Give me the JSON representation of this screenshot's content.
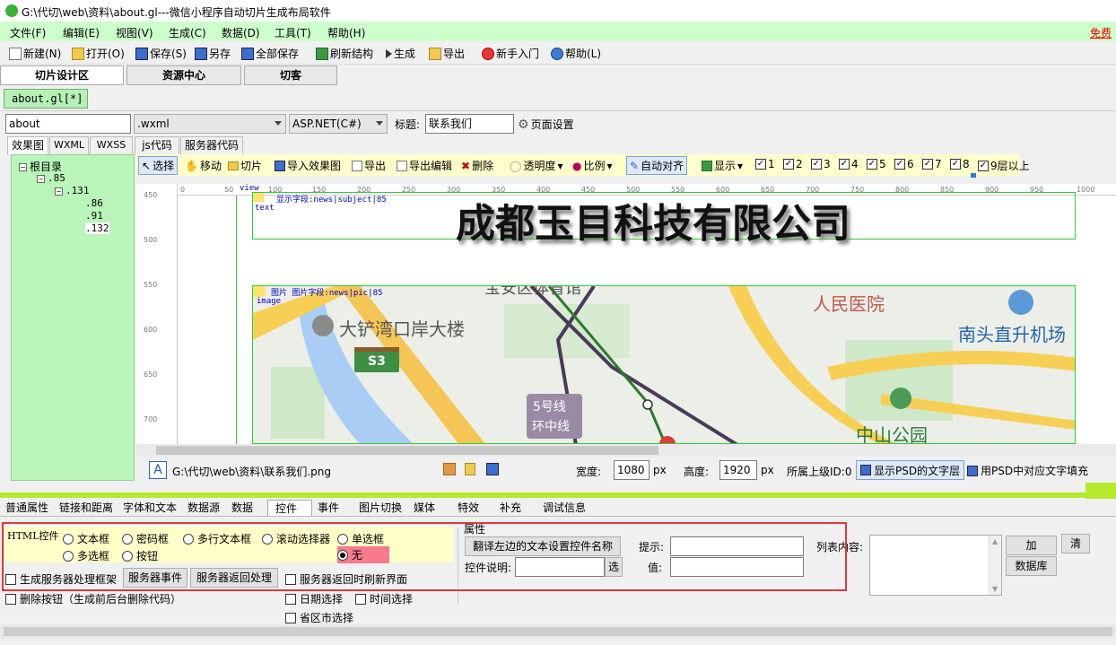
{
  "window": {
    "title": "G:\\代切\\web\\资料\\about.gl---微信小程序自动切片生成布局软件"
  },
  "menu": {
    "items": [
      "文件(F)",
      "编辑(E)",
      "视图(V)",
      "生成(C)",
      "数据(D)",
      "工具(T)",
      "帮助(H)"
    ],
    "right_link": "免费"
  },
  "toolbar": {
    "new": "新建(N)",
    "open": "打开(O)",
    "save": "保存(S)",
    "save_as": "另存",
    "save_all": "全部保存",
    "refresh": "刷新结构",
    "generate": "生成",
    "export": "导出",
    "tutorial": "新手入门",
    "help": "帮助(L)"
  },
  "main_tabs": [
    "切片设计区",
    "资源中心",
    "切客"
  ],
  "file_tab": "about.gl[*]",
  "inputs": {
    "name_value": "about",
    "ext_select": ".wxml",
    "lang_select": "ASP.NET(C#)",
    "title_label": "标题:",
    "title_value": "联系我们",
    "page_settings": "页面设置"
  },
  "sub_tabs": [
    "效果图",
    "WXML",
    "WXSS",
    "js代码",
    "服务器代码"
  ],
  "tree": {
    "root": "根目录",
    "n1": ".85",
    "n2": ".131",
    "leaves": [
      ".86",
      ".91",
      ".132"
    ]
  },
  "design_toolbar": {
    "select": "选择",
    "move": "移动",
    "slice": "切片",
    "import": "导入效果图",
    "export": "导出",
    "export_edit": "导出编辑",
    "delete": "删除",
    "opacity": "透明度",
    "ratio": "比例",
    "auto_align": "自动对齐",
    "display": "显示",
    "layers": [
      "1",
      "2",
      "3",
      "4",
      "5",
      "6",
      "7",
      "8",
      "9层以上"
    ]
  },
  "ruler": {
    "h": [
      "0",
      "50",
      "100",
      "150",
      "200",
      "250",
      "300",
      "350",
      "400",
      "450",
      "500",
      "550",
      "600",
      "650",
      "700",
      "750",
      "800",
      "850",
      "900",
      "950",
      "1000"
    ],
    "v": [
      "450",
      "500",
      "550",
      "600",
      "650",
      "700"
    ]
  },
  "canvas": {
    "view_label": "view",
    "text_field_label": "显示字段:news|subject|85",
    "text_label": "text",
    "company": "成都玉目科技有限公司",
    "image_label": "图片 图片字段:news|pic|85",
    "image_tag": "image",
    "map_labels": {
      "building": "大铲湾口岸大楼",
      "hospital": "人民医院",
      "heliport": "南头直升机场",
      "park": "中山公园",
      "line5": "5号线",
      "station": "环中线",
      "badge": "S3",
      "top": "宝安区体育馆"
    }
  },
  "pathbar": {
    "path": "G:\\代切\\web\\资料\\联系我们.png",
    "width_label": "宽度:",
    "width_value": "1080",
    "px1": "px",
    "height_label": "高度:",
    "height_value": "1920",
    "px2": "px",
    "parent_id": "所属上级ID:0",
    "show_psd": "显示PSD的文字层",
    "fill_psd": "用PSD中对应文字填充"
  },
  "prop_tabs": [
    "普通属性",
    "链接和距离",
    "字体和文本",
    "数据源",
    "数据",
    "控件",
    "事件",
    "图片切换",
    "媒体",
    "特效",
    "补充",
    "调试信息"
  ],
  "controls": {
    "html_label": "HTML控件",
    "radios": [
      "文本框",
      "密码框",
      "多行文本框",
      "滚动选择器",
      "单选框",
      "多选框",
      "按钮",
      "无"
    ],
    "selected": "无",
    "gen_server": "生成服务器处理框架",
    "server_event": "服务器事件",
    "server_return": "服务器返回处理",
    "refresh_on_return": "服务器返回时刷新界面",
    "delete_btn": "删除按钮（生成前后台删除代码）",
    "date_sel": "日期选择",
    "time_sel": "时间选择",
    "region_sel": "省区市选择",
    "attr_label": "属性",
    "translate_btn": "翻译左边的文本设置控件名称",
    "hint_label": "提示:",
    "desc_label": "控件说明:",
    "choose_btn": "选",
    "value_label": "值:",
    "list_label": "列表内容:",
    "add_btn": "加",
    "clear_btn": "清",
    "db_btn": "数据库"
  }
}
